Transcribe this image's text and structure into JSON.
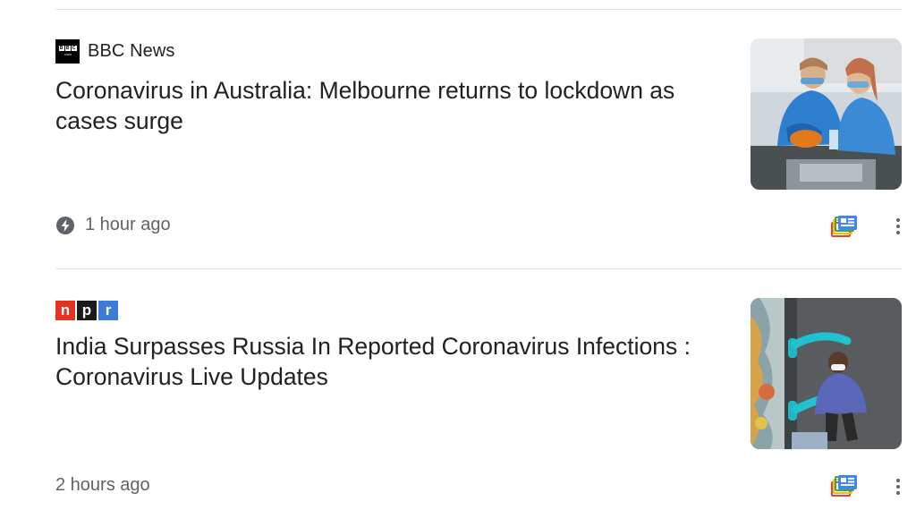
{
  "articles": [
    {
      "publisher": "BBC News",
      "publisher_logo": "bbc-logo",
      "headline": "Coronavirus in Australia: Melbourne returns to lockdown as cases surge",
      "time": "1 hour ago",
      "has_breaking_icon": true,
      "thumbnail": "health workers in blue protective gear and masks"
    },
    {
      "publisher": "npr",
      "publisher_logo": "npr-logo",
      "headline": "India Surpasses Russia In Reported Coronavirus Infections : Coronavirus Live Updates",
      "time": "2 hours ago",
      "has_breaking_icon": false,
      "thumbnail": "health worker in mask beside blue tubes"
    }
  ],
  "icons": {
    "breaking": "bolt-icon",
    "full_coverage": "full-coverage-icon",
    "more": "more-vert-icon"
  },
  "colors": {
    "text": "#202124",
    "secondary": "#5f6368",
    "npr_n": "#e3341f",
    "npr_p": "#1a1a1a",
    "npr_r": "#3a7cd8"
  }
}
